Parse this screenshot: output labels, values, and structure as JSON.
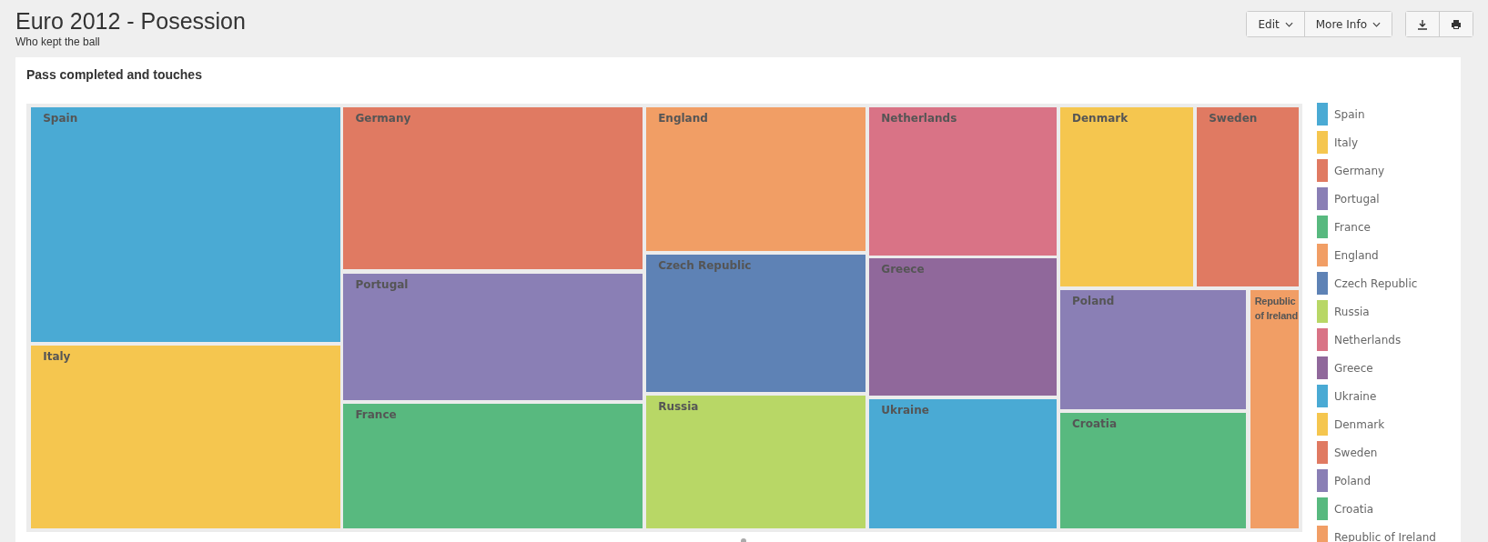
{
  "header": {
    "title": "Euro 2012 - Posession",
    "subtitle": "Who kept the ball"
  },
  "toolbar": {
    "menus": [
      {
        "label": "Edit"
      },
      {
        "label": "More Info"
      }
    ],
    "actions": [
      {
        "kind": "download"
      },
      {
        "kind": "print"
      }
    ]
  },
  "card": {
    "title": "Pass completed and touches",
    "treemap": {
      "tiles": [
        {
          "label": "Spain",
          "color": "#4aaad4"
        },
        {
          "label": "Italy",
          "color": "#f5c64f"
        },
        {
          "label": "Germany",
          "color": "#e07a62"
        },
        {
          "label": "Portugal",
          "color": "#8a7fb5"
        },
        {
          "label": "France",
          "color": "#58b97f"
        },
        {
          "label": "England",
          "color": "#f19e65"
        },
        {
          "label": "Czech Republic",
          "color": "#5e82b5"
        },
        {
          "label": "Russia",
          "color": "#b8d766"
        },
        {
          "label": "Netherlands",
          "color": "#d97386"
        },
        {
          "label": "Greece",
          "color": "#90689b"
        },
        {
          "label": "Ukraine",
          "color": "#4aaad4"
        },
        {
          "label": "Denmark",
          "color": "#f5c64f"
        },
        {
          "label": "Sweden",
          "color": "#e07a62"
        },
        {
          "label": "Poland",
          "color": "#8a7fb5"
        },
        {
          "label": "Croatia",
          "color": "#58b97f"
        },
        {
          "label": "Republic of Ireland",
          "color": "#f19e65"
        }
      ]
    },
    "legend": [
      {
        "label": "Spain",
        "color": "#4aaad4"
      },
      {
        "label": "Italy",
        "color": "#f5c64f"
      },
      {
        "label": "Germany",
        "color": "#e07a62"
      },
      {
        "label": "Portugal",
        "color": "#8a7fb5"
      },
      {
        "label": "France",
        "color": "#58b97f"
      },
      {
        "label": "England",
        "color": "#f19e65"
      },
      {
        "label": "Czech Republic",
        "color": "#5e82b5"
      },
      {
        "label": "Russia",
        "color": "#b8d766"
      },
      {
        "label": "Netherlands",
        "color": "#d97386"
      },
      {
        "label": "Greece",
        "color": "#90689b"
      },
      {
        "label": "Ukraine",
        "color": "#4aaad4"
      },
      {
        "label": "Denmark",
        "color": "#f5c64f"
      },
      {
        "label": "Sweden",
        "color": "#e07a62"
      },
      {
        "label": "Poland",
        "color": "#8a7fb5"
      },
      {
        "label": "Croatia",
        "color": "#58b97f"
      },
      {
        "label": "Republic of Ireland",
        "color": "#f19e65"
      }
    ]
  }
}
